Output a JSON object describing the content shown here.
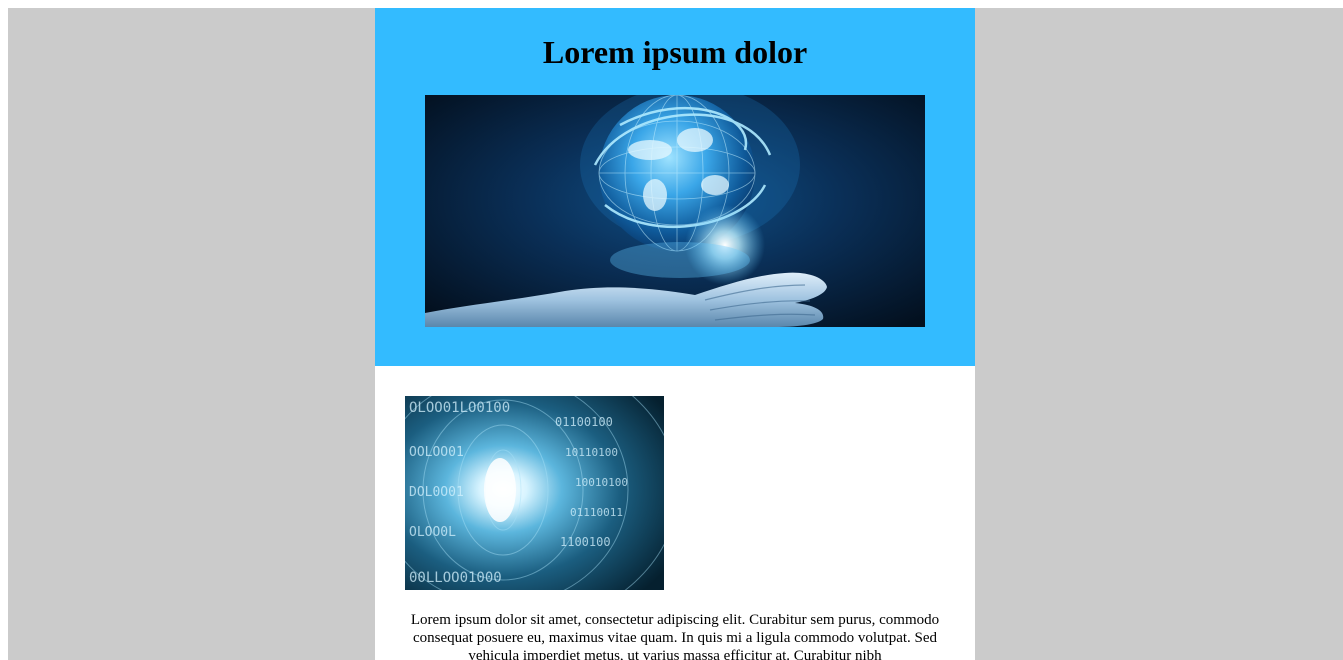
{
  "page": {
    "background_color": "#cbcbcb",
    "email_background_color": "#ffffff"
  },
  "header": {
    "title": "Lorem ipsum dolor",
    "background_color": "#33bbff",
    "image_icon": "globe-in-hand-image"
  },
  "content": {
    "image_icon": "binary-tunnel-image",
    "body_text": "Lorem ipsum dolor sit amet, consectetur adipiscing elit. Curabitur sem purus, commodo consequat posuere eu, maximus vitae quam. In quis mi a ligula commodo volutpat. Sed vehicula imperdiet metus, ut varius massa efficitur at. Curabitur nibh"
  }
}
